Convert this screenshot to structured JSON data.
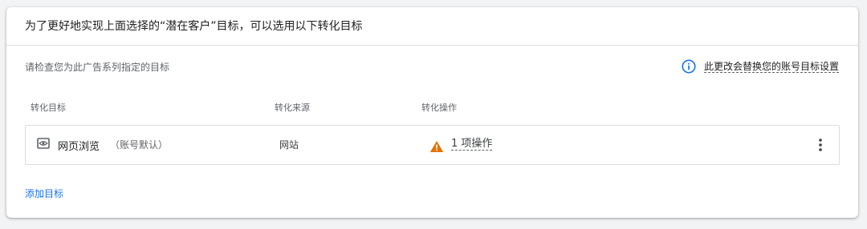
{
  "header": {
    "title": "为了更好地实现上面选择的“潜在客户”目标，可以选用以下转化目标"
  },
  "section": {
    "subtitle": "请检查您为此广告系列指定的目标",
    "info_link": "此更改会替换您的账号目标设置",
    "info_icon": "info-icon"
  },
  "table": {
    "columns": [
      "转化目标",
      "转化来源",
      "转化操作"
    ],
    "rows": [
      {
        "goal_icon": "eye-icon",
        "goal": "网页浏览",
        "goal_note": "（账号默认）",
        "source": "网站",
        "warning_icon": "warning-icon",
        "actions": "1 项操作"
      }
    ]
  },
  "footer": {
    "add_goal": "添加目标"
  },
  "colors": {
    "accent": "#1a73e8",
    "warning": "#e37400",
    "border": "#dadce0",
    "background": "#f1f3f4"
  }
}
